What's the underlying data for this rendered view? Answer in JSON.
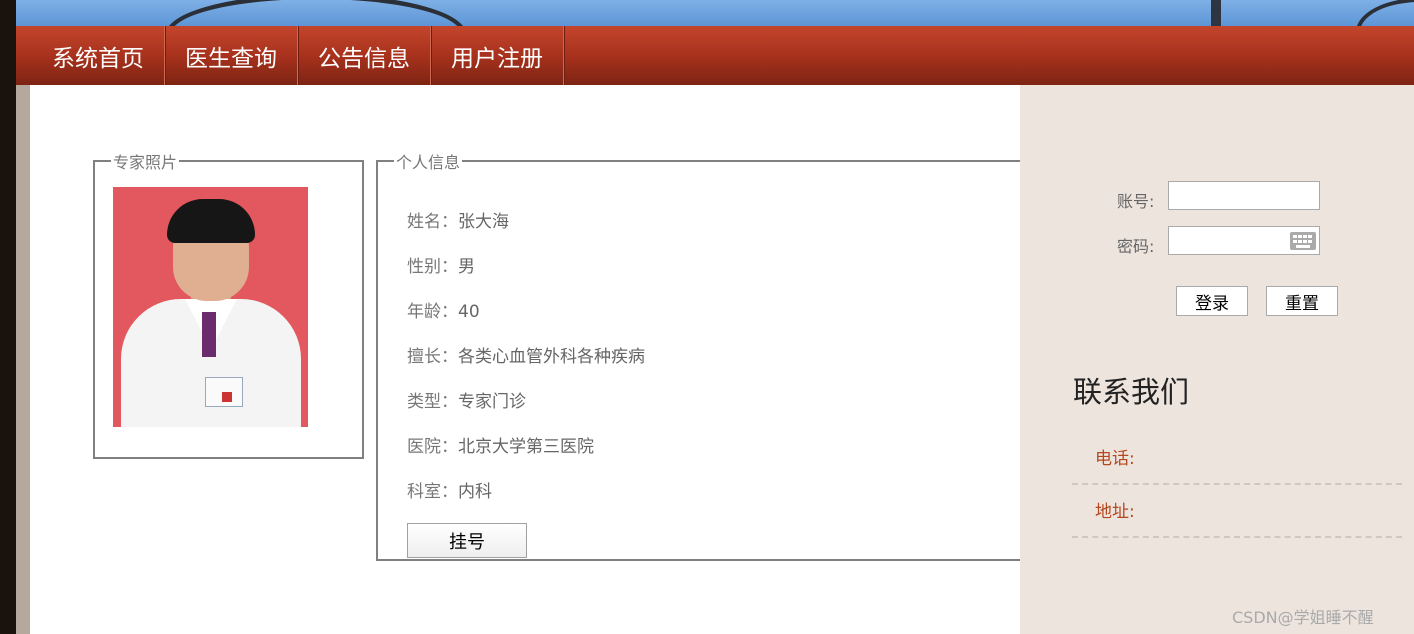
{
  "nav": {
    "items": [
      {
        "label": "系统首页"
      },
      {
        "label": "医生查询"
      },
      {
        "label": "公告信息"
      },
      {
        "label": "用户注册"
      }
    ]
  },
  "photo_section": {
    "legend": "专家照片"
  },
  "info_section": {
    "legend": "个人信息",
    "fields": [
      {
        "label": "姓名：",
        "value": "张大海"
      },
      {
        "label": "性别：",
        "value": "男"
      },
      {
        "label": "年龄：",
        "value": "40"
      },
      {
        "label": "擅长：",
        "value": "各类心血管外科各种疾病"
      },
      {
        "label": "类型：",
        "value": "专家门诊"
      },
      {
        "label": "医院：",
        "value": "北京大学第三医院"
      },
      {
        "label": "科室：",
        "value": "内科"
      }
    ],
    "register_label": "挂号"
  },
  "login": {
    "account_label": "账号:",
    "account_value": "",
    "password_label": "密码:",
    "password_value": "",
    "login_label": "登录",
    "reset_label": "重置"
  },
  "contact": {
    "title": "联系我们",
    "phone_label": "电话:",
    "address_label": "地址:"
  },
  "watermark": "CSDN@学姐睡不醒",
  "colors": {
    "nav_bg": "#a8321d",
    "sidebar_bg": "#ede4dd",
    "contact_label": "#b5471f"
  },
  "icons": {
    "keyboard": "keyboard-icon"
  }
}
